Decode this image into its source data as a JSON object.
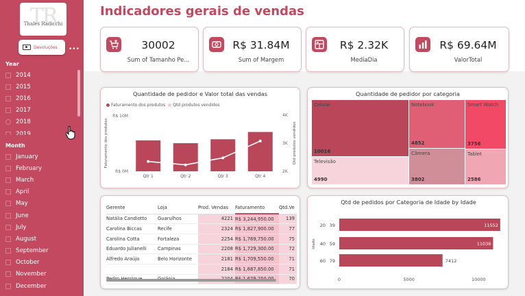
{
  "sidebar": {
    "logo_monogram": "TR",
    "logo_name": "Thales Radicchi",
    "dev_button_label": "Devoluções",
    "year_title": "Year",
    "years": [
      "2014",
      "2015",
      "2016",
      "2017",
      "2018",
      "2019"
    ],
    "month_title": "Month",
    "months": [
      "January",
      "February",
      "March",
      "April",
      "May",
      "June",
      "July",
      "August",
      "September",
      "October",
      "November",
      "December"
    ]
  },
  "header": {
    "title": "Indicadores gerais de vendas"
  },
  "kpis": [
    {
      "icon": "cart-icon",
      "value": "30002",
      "label": "Sum of Tamanho Pe..."
    },
    {
      "icon": "money-icon",
      "value": "R$ 31.84M",
      "label": "Sum of Margem"
    },
    {
      "icon": "dashboard-icon",
      "value": "R$ 2.32K",
      "label": "MediaDia"
    },
    {
      "icon": "bar-chart-icon",
      "value": "R$ 69.64M",
      "label": "ValorTotal"
    }
  ],
  "combo_chart": {
    "title": "Quantidade de pedidor e Valor total das vendas",
    "legend_bar": "Faturamento dos produtos",
    "legend_line": "Qtd produtos vendidos",
    "y_left_label": "Faturamento dos produtos",
    "y_right_label": "Qtd produtos vendidos",
    "y_left_ticks": [
      "R$ 10M",
      "R$ 0M"
    ],
    "y_right_ticks": [
      "4K",
      "3K",
      "2K"
    ]
  },
  "treemap": {
    "title": "Quantidade de pedidor por categoria",
    "cells": [
      {
        "name": "Celular",
        "value": "10016"
      },
      {
        "name": "Televisão",
        "value": "4990"
      },
      {
        "name": "Notebook",
        "value": "4852"
      },
      {
        "name": "Câmera",
        "value": "3802"
      },
      {
        "name": "Smart Watch",
        "value": "3756"
      },
      {
        "name": "Tablet",
        "value": "2586"
      }
    ]
  },
  "table": {
    "headers": [
      "Gerente",
      "Loja",
      "Prod. Vendas",
      "Faturamento",
      "Qtd.Ve"
    ],
    "rows": [
      [
        "Natália Candiotto",
        "Guarulhos",
        "4221",
        "R$ 3,244,950.00",
        "139"
      ],
      [
        "Carolina Biccas",
        "Recife",
        "2324",
        "R$ 1,827,900.00",
        "77"
      ],
      [
        "Carolina Cotta",
        "Fortaleza",
        "2254",
        "R$ 1,769,750.00",
        "75"
      ],
      [
        "Eduardo Julianelli",
        "Campinas",
        "2208",
        "R$ 1,729,300.00",
        "72"
      ],
      [
        "Alfredo Araújo",
        "Belo Horizonte",
        "2181",
        "R$ 1,709,550.00",
        "71"
      ],
      [
        "",
        "",
        "2184",
        "R$ 1,687,850.00",
        "71"
      ],
      [
        "Pedro Henrique",
        "Goiânia",
        "2204",
        "R$ 1,679,250.00",
        "70"
      ]
    ]
  },
  "colors": {
    "primary": "#c2495f",
    "bar": "#b94659",
    "light": "#f7d4db"
  },
  "chart_data": [
    {
      "type": "bar",
      "title": "Quantidade de pedidor e Valor total das vendas",
      "categories": [
        "Qtr 1",
        "Qtr 2",
        "Qtr 3",
        "Qtr 4"
      ],
      "series": [
        {
          "name": "Faturamento dos produtos",
          "axis": "left",
          "values": [
            5.5,
            5.0,
            5.7,
            7.0
          ]
        },
        {
          "name": "Qtd produtos vendidos",
          "axis": "right",
          "type": "line",
          "values": [
            2350,
            2230,
            2480,
            3080
          ]
        }
      ],
      "ylim_left": [
        0,
        10
      ],
      "ylim_right": [
        2000,
        4000
      ],
      "ylabel": "Faturamento dos produtos",
      "ylabel_right": "Qtd produtos vendidos"
    },
    {
      "type": "bar",
      "orientation": "horizontal",
      "title": "Qtd de pedidos por Categoria de Idade by Idade",
      "ylabel": "Idade",
      "categories": [
        "20 - 39",
        "40 - 59",
        "60 - 79"
      ],
      "values": [
        11552,
        11038,
        7412
      ],
      "xticks": [
        "0",
        "5000",
        "10000"
      ],
      "xlim": [
        0,
        12000
      ]
    }
  ]
}
